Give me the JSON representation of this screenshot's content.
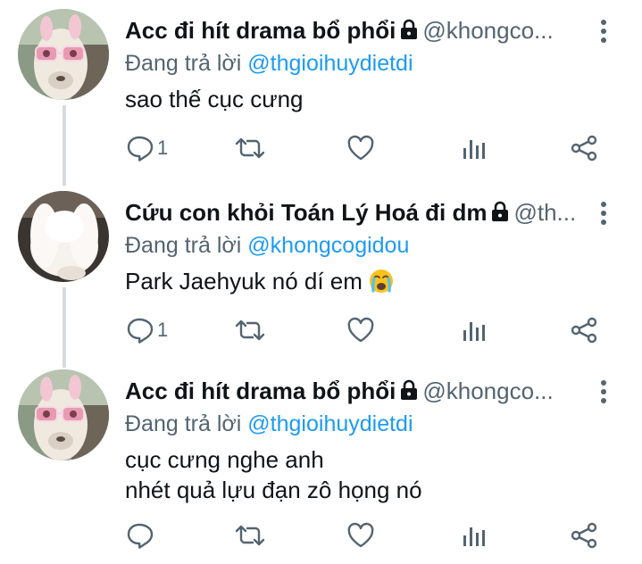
{
  "tweets": [
    {
      "display_name": "Acc đi hít drama bổ phổi",
      "handle": "@khongco...",
      "replying_prefix": "Đang trả lời",
      "replying_to": "@thgioihuydietdi",
      "lines": [
        "sao thế cục cưng"
      ],
      "reply_count": "1",
      "avatar": "alpaca-sunglasses"
    },
    {
      "display_name": "Cứu con khỏi Toán Lý Hoá đi dm",
      "handle": "@th...",
      "replying_prefix": "Đang trả lời",
      "replying_to": "@khongcogidou",
      "lines": [
        "Park Jaehyuk nó dí em"
      ],
      "emoji": "loudly-crying-face",
      "reply_count": "1",
      "avatar": "white-rabbit"
    },
    {
      "display_name": "Acc đi hít drama bổ phổi",
      "handle": "@khongco...",
      "replying_prefix": "Đang trả lời",
      "replying_to": "@thgioihuydietdi",
      "lines": [
        "cục cưng nghe anh",
        "nhét quả lựu đạn zô họng nó"
      ],
      "reply_count": "",
      "avatar": "alpaca-sunglasses"
    }
  ],
  "icons": {
    "lock": "lock-icon",
    "more": "more-vertical-icon",
    "reply": "reply-icon",
    "retweet": "retweet-icon",
    "like": "heart-icon",
    "views": "analytics-icon",
    "share": "share-icon"
  },
  "colors": {
    "text": "#0f1419",
    "secondary": "#536471",
    "accent": "#1d9bf0",
    "thread_line": "#d6dbdf"
  }
}
